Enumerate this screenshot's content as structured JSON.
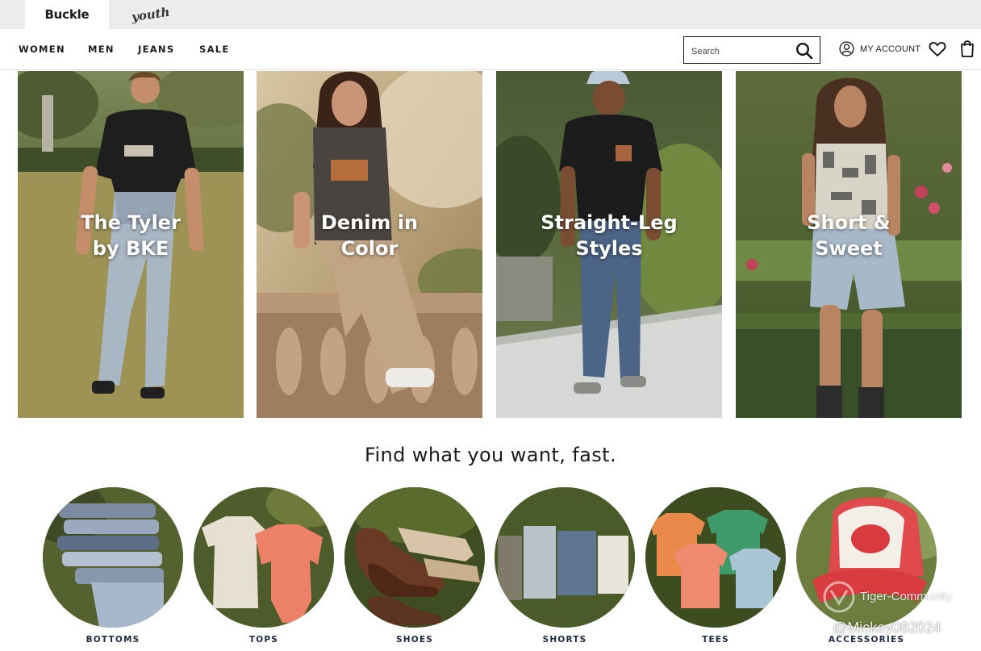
{
  "brand_bar": {
    "tabs": [
      {
        "label": "Buckle",
        "active": true
      },
      {
        "label": "youth",
        "active": false
      }
    ]
  },
  "nav": {
    "items": [
      "WOMEN",
      "MEN",
      "JEANS",
      "SALE"
    ],
    "search": {
      "placeholder": "Search",
      "value": ""
    },
    "account_label": "MY ACCOUNT"
  },
  "hero": {
    "tiles": [
      {
        "title": "The Tyler\nby BKE"
      },
      {
        "title": "Denim in\nColor"
      },
      {
        "title": "Straight-Leg\nStyles"
      },
      {
        "title": "Short &\nSweet"
      }
    ]
  },
  "section": {
    "title": "Find what you want, fast."
  },
  "categories": [
    {
      "label": "BOTTOMS"
    },
    {
      "label": "TOPS"
    },
    {
      "label": "SHOES"
    },
    {
      "label": "SHORTS"
    },
    {
      "label": "TEES"
    },
    {
      "label": "ACCESSORIES"
    }
  ],
  "watermark": {
    "line1": "Tiger-Community",
    "line2": "@Mickey082024"
  },
  "icons": [
    "search-icon",
    "user-icon",
    "heart-icon",
    "bag-icon"
  ],
  "colors": {
    "brand_bar_bg": "#ececec",
    "text_dark": "#1c1c1c",
    "category_label": "#1f2a44"
  }
}
